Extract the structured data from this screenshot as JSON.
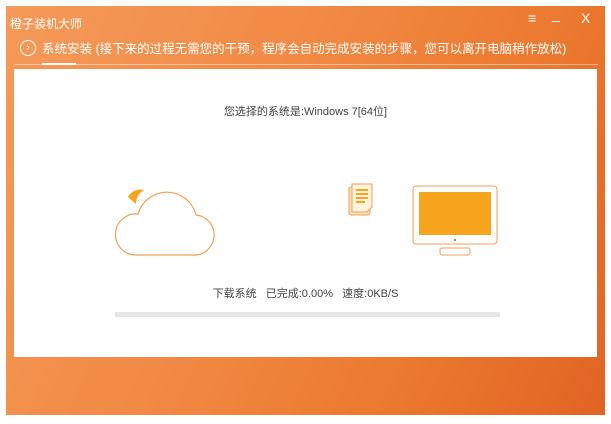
{
  "app": {
    "title": "橙子装机大师"
  },
  "controls": {
    "menu": "≡",
    "minimize": "_",
    "close": "X"
  },
  "step": {
    "label": "系统安装 (接下来的过程无需您的干预，程序会自动完成安装的步骤，您可以离开电脑稍作放松)"
  },
  "main": {
    "selected_system": "您选择的系统是:Windows 7[64位]",
    "status": {
      "action": "下载系统",
      "progress_text": "已完成:0.00%",
      "speed_text": "速度:0KB/S"
    },
    "progress_percent": 0
  },
  "colors": {
    "accent": "#f7a51f",
    "line": "#eea15a"
  }
}
